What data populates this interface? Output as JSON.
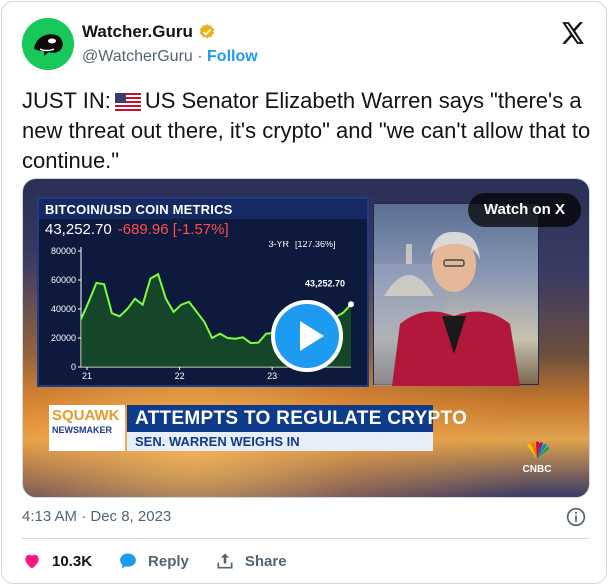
{
  "account": {
    "name": "Watcher.Guru",
    "handle": "@WatcherGuru",
    "separator": "·",
    "follow_label": "Follow"
  },
  "tweet": {
    "text_prefix": "JUST IN:",
    "text_body": "US Senator Elizabeth Warren says \"there's a new threat out there, it's crypto\" and \"we can't allow that to continue.\"",
    "timestamp": "4:13 AM · Dec 8, 2023"
  },
  "media": {
    "watch_label": "Watch on X",
    "chart_title": "BITCOIN/USD COIN METRICS",
    "price": "43,252.70",
    "change": "-689.96 [-1.57%]",
    "range_label": "3-YR",
    "range_change": "[127.36%]",
    "last_price_tag": "43,252.70",
    "squawk_top": "SQUAWK",
    "squawk_bottom": "NEWSMAKER",
    "headline": "ATTEMPTS TO REGULATE CRYPTO",
    "subline": "SEN. WARREN WEIGHS IN",
    "network": "CNBC"
  },
  "chart_data": {
    "type": "line",
    "title": "BITCOIN/USD COIN METRICS",
    "x_tick_labels": [
      "21",
      "22",
      "23"
    ],
    "y_tick_labels": [
      "80000",
      "60000",
      "40000",
      "20000",
      "0"
    ],
    "ylim": [
      0,
      80000
    ],
    "x": [
      "21-01",
      "21-02",
      "21-03",
      "21-04",
      "21-05",
      "21-06",
      "21-07",
      "21-08",
      "21-09",
      "21-10",
      "21-11",
      "21-12",
      "22-01",
      "22-02",
      "22-03",
      "22-04",
      "22-05",
      "22-06",
      "22-07",
      "22-08",
      "22-09",
      "22-10",
      "22-11",
      "22-12",
      "23-01",
      "23-02",
      "23-03",
      "23-04",
      "23-05",
      "23-06",
      "23-07",
      "23-08",
      "23-09",
      "23-10",
      "23-11",
      "23-12"
    ],
    "series": [
      {
        "values": [
          33000,
          45000,
          58000,
          57000,
          37000,
          35000,
          40000,
          47000,
          43000,
          61000,
          64000,
          47000,
          38000,
          43000,
          45000,
          38000,
          31000,
          20000,
          23000,
          20000,
          19500,
          20500,
          16500,
          16800,
          23000,
          23500,
          28000,
          29500,
          27000,
          30500,
          29500,
          26000,
          27000,
          34500,
          37500,
          43252.7
        ]
      }
    ]
  },
  "actions": {
    "likes": "10.3K",
    "reply_label": "Reply",
    "share_label": "Share"
  },
  "icons": {
    "verified": "verified-badge-icon",
    "platform": "x-logo-icon",
    "info": "info-icon",
    "like": "heart-icon",
    "reply": "reply-bubble-icon",
    "share": "share-icon",
    "flag": "us-flag-icon",
    "play": "play-icon"
  },
  "colors": {
    "accent": "#1d9bf0",
    "like": "#f91880",
    "chart_line": "#7cff3a"
  }
}
